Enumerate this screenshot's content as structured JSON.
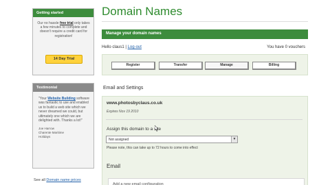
{
  "sidebar": {
    "promo": {
      "heading": "Getting started",
      "text_before": "Our no hassle ",
      "free_trial": "free trial",
      "text_after": " only takes a few minutes to complete and doesn't require a credit card for registration!",
      "button": "14 Day Trial"
    },
    "testimonial": {
      "heading": "Testimonial",
      "quote_before": "\"Your ",
      "link": "Website Building",
      "quote_after": " software was fantastic to use and enabled us to build a web site which we never dreamed we could, but ultimately one which we are delighted with. Thanks a lot!\"",
      "author_name": "Joe Harrow",
      "author_line2": "Charente Maritime",
      "author_line3": "Holidays"
    },
    "see_all_prefix": "See all ",
    "see_all_link": "Domain name prices"
  },
  "main": {
    "title": "Domain Names",
    "manage_bar": "Manage your domain names",
    "hello": "Hello claus1 | ",
    "logout": "Log-out",
    "vouchers": "You have 0 vouchers",
    "tabs": [
      "Register",
      "Transfer",
      "Manage",
      "Billing"
    ],
    "section_title": "Email and Settings",
    "domain": "www.photosbyclaus.co.uk",
    "expires": "Expires Nov 19 2010",
    "assign_label": "Assign this domain to a site",
    "select_value": "Not assigned",
    "note": "Please note, this can take up to 72 hours to come into effect",
    "email_heading": "Email",
    "add_email": "Add a new email configuration"
  }
}
